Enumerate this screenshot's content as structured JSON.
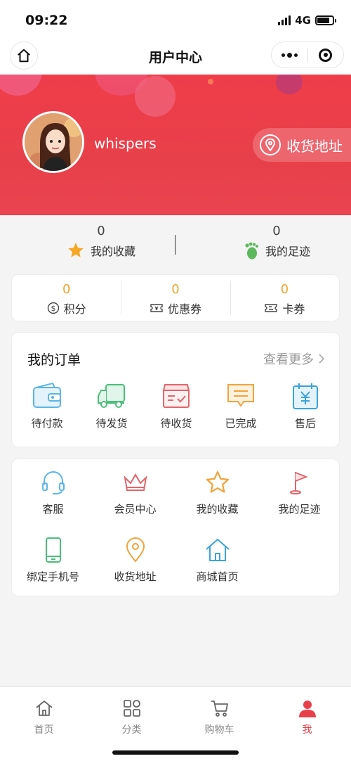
{
  "status_bar": {
    "time": "09:22",
    "network": "4G"
  },
  "nav": {
    "title": "用户中心"
  },
  "profile": {
    "username": "whispers",
    "address_button": "收货地址"
  },
  "stats": [
    {
      "count": "0",
      "label": "我的收藏",
      "icon": "star-icon"
    },
    {
      "count": "0",
      "label": "我的足迹",
      "icon": "footprint-icon"
    }
  ],
  "wallet": [
    {
      "count": "0",
      "label": "积分",
      "icon": "points-icon"
    },
    {
      "count": "0",
      "label": "优惠券",
      "icon": "coupon-icon"
    },
    {
      "count": "0",
      "label": "卡券",
      "icon": "card-icon"
    }
  ],
  "orders": {
    "title": "我的订单",
    "more": "查看更多",
    "items": [
      {
        "label": "待付款",
        "icon": "wallet-icon"
      },
      {
        "label": "待发货",
        "icon": "truck-icon"
      },
      {
        "label": "待收货",
        "icon": "package-icon"
      },
      {
        "label": "已完成",
        "icon": "message-icon"
      },
      {
        "label": "售后",
        "icon": "after-sale-icon"
      }
    ]
  },
  "services": [
    {
      "label": "客服",
      "icon": "headset-icon"
    },
    {
      "label": "会员中心",
      "icon": "crown-icon"
    },
    {
      "label": "我的收藏",
      "icon": "star-outline-icon"
    },
    {
      "label": "我的足迹",
      "icon": "flag-icon"
    },
    {
      "label": "绑定手机号",
      "icon": "phone-icon"
    },
    {
      "label": "收货地址",
      "icon": "location-icon"
    },
    {
      "label": "商城首页",
      "icon": "house-icon"
    }
  ],
  "tabbar": [
    {
      "label": "首页",
      "icon": "home-icon",
      "active": false
    },
    {
      "label": "分类",
      "icon": "category-icon",
      "active": false
    },
    {
      "label": "购物车",
      "icon": "cart-icon",
      "active": false
    },
    {
      "label": "我",
      "icon": "user-icon",
      "active": true
    }
  ],
  "colors": {
    "brand": "#e8404a",
    "accent": "#f2a32a",
    "background": "#f4f4f4"
  }
}
